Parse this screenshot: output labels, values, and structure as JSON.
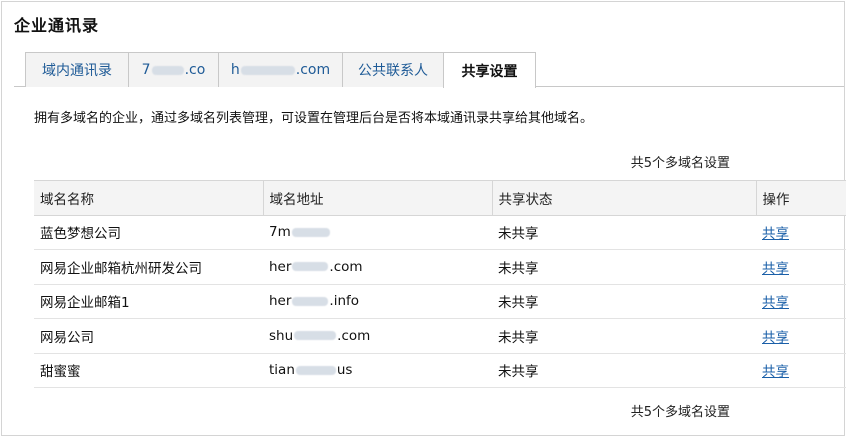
{
  "page": {
    "title": "企业通讯录"
  },
  "tabs": [
    {
      "label": "域内通讯录",
      "active": false
    },
    {
      "label_prefix": "7",
      "label_suffix": ".co",
      "active": false
    },
    {
      "label_prefix": "h",
      "label_suffix": ".com",
      "active": false
    },
    {
      "label": "公共联系人",
      "active": false
    },
    {
      "label": "共享设置",
      "active": true
    }
  ],
  "description": "拥有多域名的企业，通过多域名列表管理，可设置在管理后台是否将本域通讯录共享给其他域名。",
  "summary_top": "共5个多域名设置",
  "summary_bottom": "共5个多域名设置",
  "table": {
    "headers": {
      "name": "域名名称",
      "address": "域名地址",
      "status": "共享状态",
      "action": "操作"
    },
    "rows": [
      {
        "name": "蓝色梦想公司",
        "addr_prefix": "7m",
        "addr_suffix": "",
        "status": "未共享",
        "action": "共享"
      },
      {
        "name": "网易企业邮箱杭州研发公司",
        "addr_prefix": "her",
        "addr_suffix": ".com",
        "status": "未共享",
        "action": "共享"
      },
      {
        "name": "网易企业邮箱1",
        "addr_prefix": "her",
        "addr_suffix": ".info",
        "status": "未共享",
        "action": "共享"
      },
      {
        "name": "网易公司",
        "addr_prefix": "shu",
        "addr_suffix": ".com",
        "status": "未共享",
        "action": "共享"
      },
      {
        "name": "甜蜜蜜",
        "addr_prefix": "tian",
        "addr_suffix": "us",
        "status": "未共享",
        "action": "共享"
      }
    ]
  },
  "colors": {
    "link": "#1a5fa8",
    "tab_text": "#1f5b97",
    "header_bg": "#f4f4f4"
  }
}
